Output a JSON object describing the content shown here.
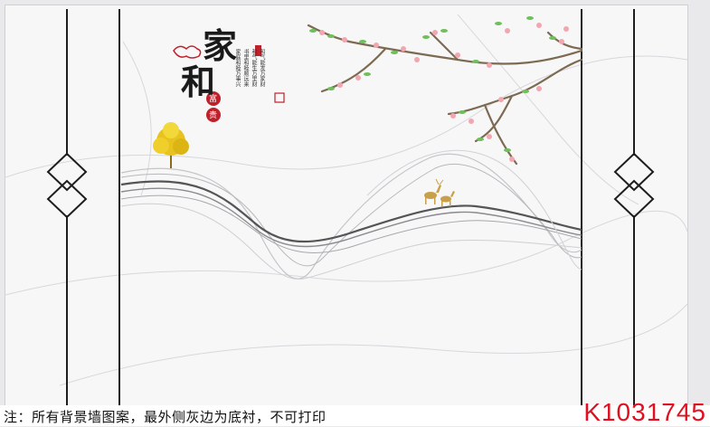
{
  "calligraphy": {
    "char1": "家",
    "char2": "和",
    "seal1": "富",
    "seal2": "贵",
    "poem": [
      "和气能发万家财",
      "和气能生万里财",
      "书里和睦顺远来",
      "家庭和睦万事兴"
    ]
  },
  "footer": {
    "note": "注：所有背景墙图案，最外侧灰边为底衬，不可打印",
    "code": "K1031745"
  },
  "colors": {
    "background": "#f7f7f8",
    "frame_line": "#1e1e1e",
    "code_red": "#e01020",
    "blossom": "#f2a6b0",
    "leaf": "#6fbf5a",
    "gold_tree": "#e8c21e"
  }
}
